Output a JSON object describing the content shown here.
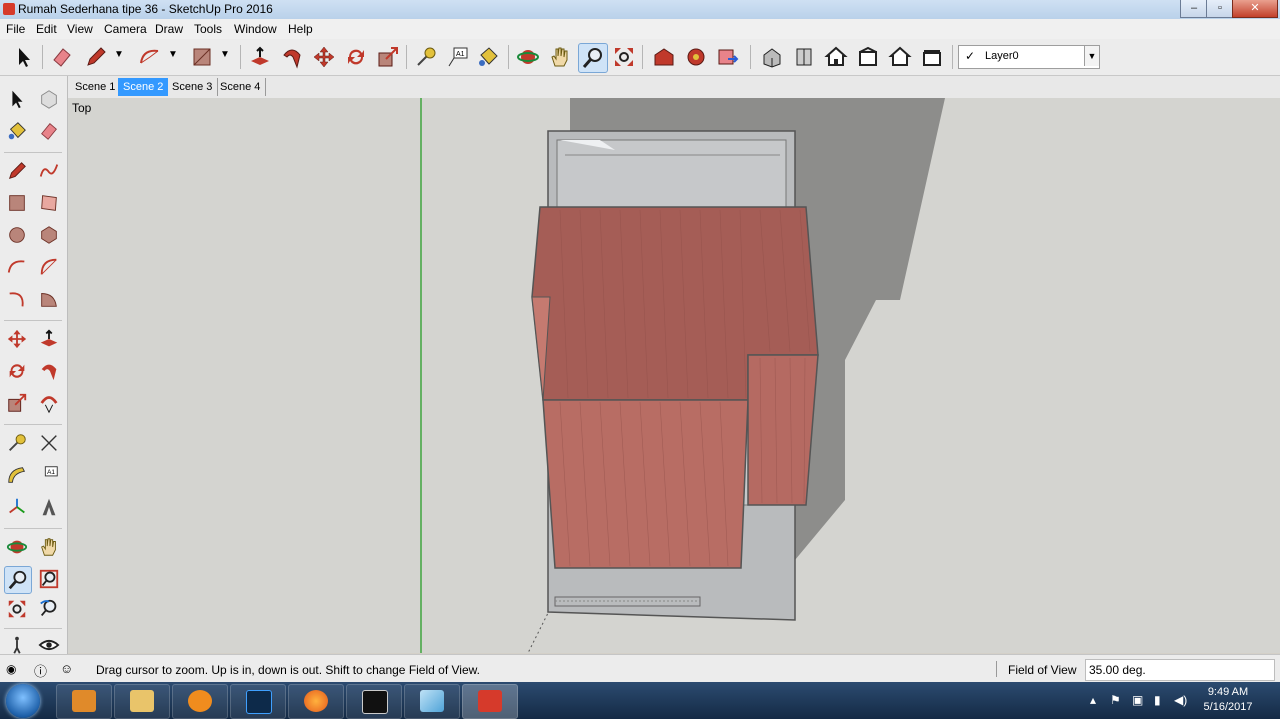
{
  "window": {
    "title": "Rumah Sederhana tipe 36 - SketchUp Pro 2016",
    "min": "–",
    "max": "▫",
    "close": "✕"
  },
  "menu": [
    "File",
    "Edit",
    "View",
    "Camera",
    "Draw",
    "Tools",
    "Window",
    "Help"
  ],
  "toolbar": {
    "layer": {
      "check": "✓",
      "name": "Layer0",
      "dropdown": "▼"
    }
  },
  "scenes": {
    "tabs": [
      "Scene 1",
      "Scene 2",
      "Scene 3",
      "Scene 4"
    ],
    "active": "Scene 2"
  },
  "viewport": {
    "label": "Top"
  },
  "status": {
    "message": "Drag cursor to zoom.  Up is in, down is out. Shift to change Field of View.",
    "vcb_label": "Field of View",
    "vcb_value": "35.00 deg."
  },
  "taskbar": {
    "time": "9:49 AM",
    "date": "5/16/2017",
    "tray": [
      "▴",
      "⚑",
      "▣",
      "◀)"
    ]
  },
  "colors": {
    "roof": "#b56a62",
    "roof_dark": "#9e5a55",
    "shadow": "#8a8a88",
    "ground": "#d4d4d0",
    "axis_green": "#1a9a1a",
    "selection": "#3399ff"
  }
}
